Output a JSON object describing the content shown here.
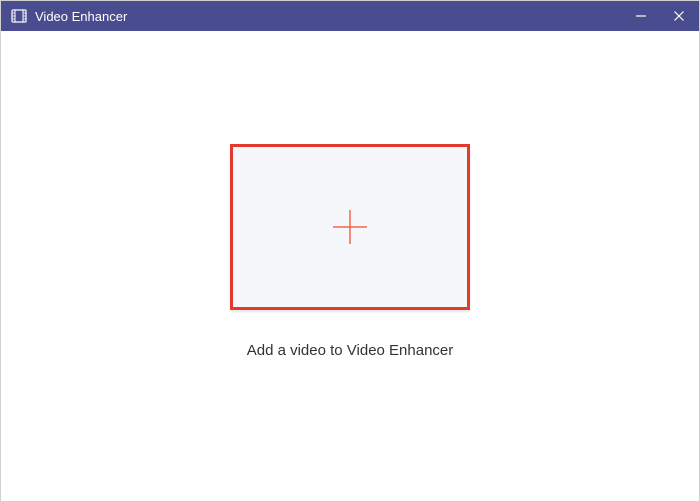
{
  "window": {
    "title": "Video Enhancer"
  },
  "main": {
    "instruction": "Add a video to Video Enhancer"
  },
  "colors": {
    "titlebar": "#494C8E",
    "highlight": "#e23a2e",
    "plus": "#f0684a"
  }
}
